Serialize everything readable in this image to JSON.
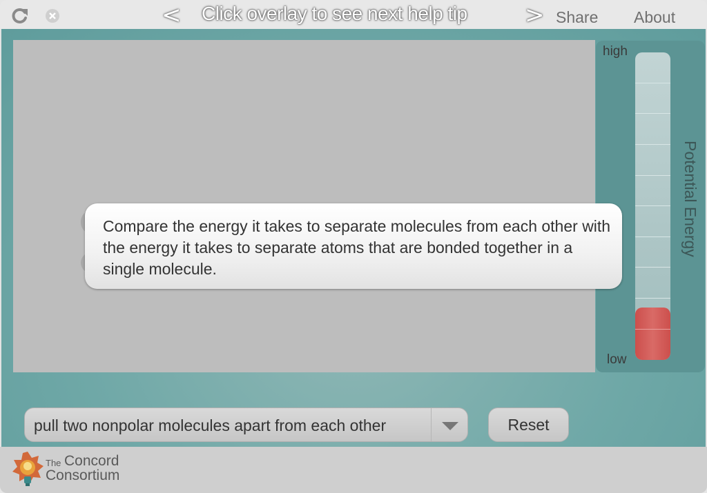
{
  "topbar": {
    "reload_icon": "reload-icon",
    "close_icon": "close-icon",
    "prev_label": "<",
    "next_label": ">",
    "help_title": "Click overlay to see next help tip",
    "share_label": "Share",
    "about_label": "About"
  },
  "energy_meter": {
    "title": "Potential Energy",
    "high_label": "high",
    "low_label": "low",
    "level_fraction": 0.17,
    "fill_color": "#cc4f4c"
  },
  "help_tip": {
    "text": "Compare the energy it takes to separate molecules from each other with the energy it takes to separate atoms that are bonded together in a single molecule."
  },
  "controls": {
    "experiment_selected": "pull two nonpolar molecules apart from each other",
    "reset_label": "Reset"
  },
  "footer": {
    "logo_the": "The",
    "logo_name_line1": "Concord",
    "logo_name_line2": "Consortium"
  },
  "colors": {
    "background_teal": "#6fa8a7",
    "canvas_gray": "#bdbdbd",
    "energy_red": "#cc4f4c"
  }
}
